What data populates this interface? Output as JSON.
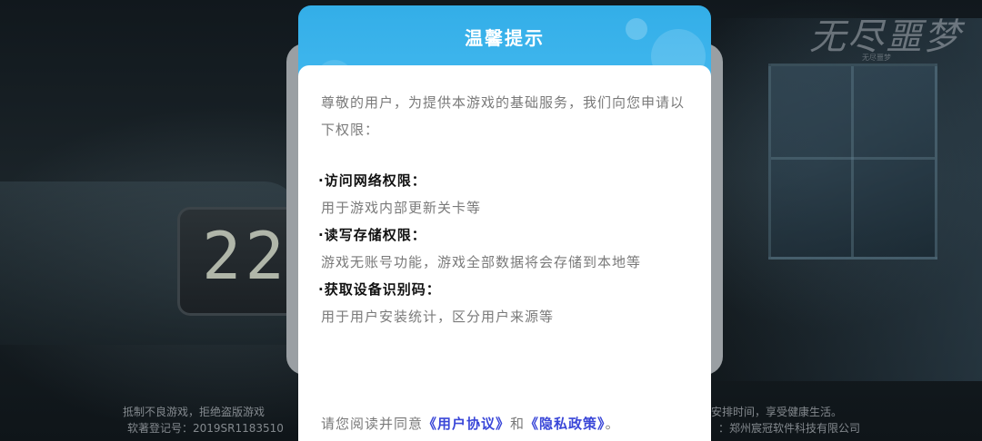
{
  "background": {
    "clock_digits": "22",
    "logo_text": "无尽噩梦",
    "logo_subtitle": "无尽噩梦",
    "notice_line_1_left": "抵制不良游戏，拒绝盗版游戏",
    "notice_line_1_right": "理安排时间，享受健康生活。",
    "notice_line_2_left": "软著登记号：2019SR1183510",
    "notice_line_2_right": "：郑州宸冠软件科技有限公司"
  },
  "dialog": {
    "title": "温馨提示",
    "intro": "尊敬的用户，为提供本游戏的基础服务，我们向您申请以下权限：",
    "permissions": [
      {
        "title": "·访问网络权限：",
        "desc": "用于游戏内部更新关卡等"
      },
      {
        "title": "·读写存储权限：",
        "desc": "游戏无账号功能，游戏全部数据将会存储到本地等"
      },
      {
        "title": "·获取设备识别码：",
        "desc": "用于用户安装统计，区分用户来源等"
      }
    ],
    "agreement": {
      "prefix": "请您阅读并同意",
      "user_agreement": "《用户协议》",
      "conjunction": "和",
      "privacy_policy": "《隐私政策》",
      "suffix": "。"
    }
  },
  "colors": {
    "header_blue": "#33aee8",
    "link_blue": "#3a47d8"
  }
}
